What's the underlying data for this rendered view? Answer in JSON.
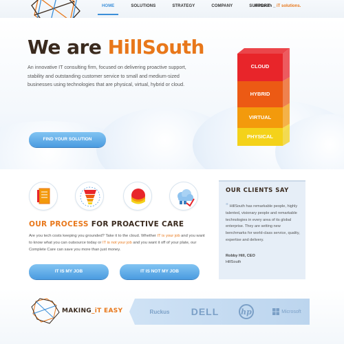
{
  "header": {
    "nav": [
      "HOME",
      "SOLUTIONS",
      "STRATEGY",
      "COMPANY",
      "SUPPORT"
    ],
    "active_index": 0,
    "tagline_prefix": "HillSouth _",
    "tagline_accent": " iT solutions."
  },
  "hero": {
    "title_prefix": "We are ",
    "title_brand": "HillSouth",
    "description": "An innovative IT consulting firm, focused on delivering proactive support, stability and outstanding customer service to small and medium-sized businesses using technologies that are physical, virtual, hybrid or cloud.",
    "button_label": "FIND YOUR SOLUTION",
    "tiers": [
      {
        "label": "CLOUD",
        "color": "#e8252a"
      },
      {
        "label": "HYBRID",
        "color": "#ec5a14"
      },
      {
        "label": "VIRTUAL",
        "color": "#f39a0c"
      },
      {
        "label": "PHYSICAL",
        "color": "#f4d21a"
      }
    ]
  },
  "process": {
    "icons": [
      "notebook-icon",
      "layers-icon",
      "storage-icon",
      "cloud-icon"
    ],
    "title_accent": "OUR PROCESS",
    "title_rest": " FOR PROACTIVE CARE",
    "text_1": "Are you tech costs keeping you grounded? Take it to the cloud. Whether ",
    "link_1": "IT is your job",
    "text_2": " and you want to know what you can outsource today or ",
    "link_2": "IT is not your job",
    "text_3": " and you want it off of your plate, our Complete Care can save you more than just money.",
    "button_1": "IT IS MY JOB",
    "button_2": "IT IS NOT MY JOB"
  },
  "clients": {
    "title": "OUR CLIENTS SAY",
    "quote_mark": "“",
    "quote": "HillSouth has remarkable people, highly talented, visionary people and remarkable technologies in every area of its global enterprise. They are setting new benchmarks for world-class service, quality, expertise and delivery.",
    "author_name": "Robby Hill, CEO",
    "author_company": "HillSouth"
  },
  "footer": {
    "making_prefix": "MAKING",
    "making_accent": "_iT EASY",
    "partners": [
      "Ruckus",
      "DELL",
      "hp",
      "Microsoft"
    ]
  },
  "colors": {
    "accent": "#e8771a",
    "brand_dark": "#3a2a1e",
    "button_blue": "#4a9be0"
  }
}
